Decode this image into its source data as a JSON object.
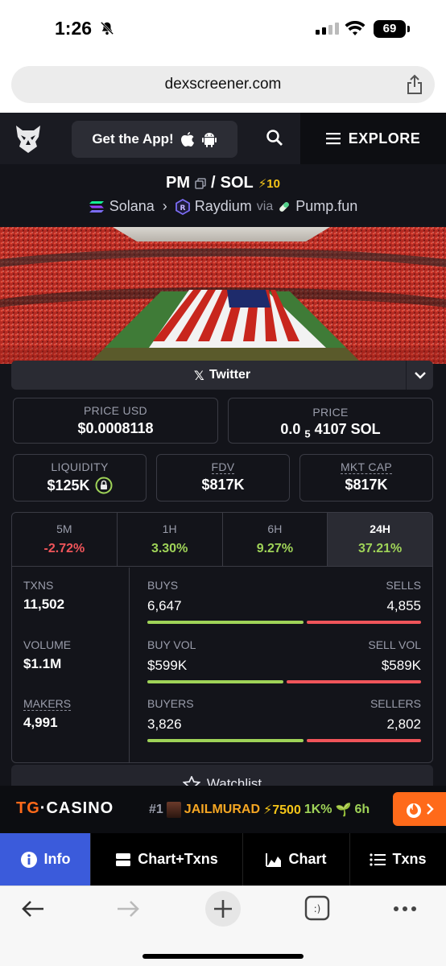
{
  "status": {
    "time": "1:26",
    "battery": "69"
  },
  "browser": {
    "url": "dexscreener.com"
  },
  "header": {
    "get_app": "Get the App!",
    "explore": "EXPLORE"
  },
  "pair": {
    "base": "PM",
    "sep": "/",
    "quote": "SOL",
    "boost": "⚡10",
    "chain": "Solana",
    "dex": "Raydium",
    "via": "via",
    "launchpad": "Pump.fun"
  },
  "social": {
    "twitter": "Twitter"
  },
  "prices": {
    "price_usd_label": "PRICE USD",
    "price_usd": "$0.0008118",
    "price_label": "PRICE",
    "price_sol_prefix": "0.0",
    "price_sol_sub": "5",
    "price_sol_rest": "4107 SOL"
  },
  "metrics": {
    "liquidity_label": "LIQUIDITY",
    "liquidity": "$125K",
    "fdv_label": "FDV",
    "fdv": "$817K",
    "mktcap_label": "MKT CAP",
    "mktcap": "$817K"
  },
  "timeframes": [
    {
      "label": "5M",
      "value": "-2.72%"
    },
    {
      "label": "1H",
      "value": "3.30%"
    },
    {
      "label": "6H",
      "value": "9.27%"
    },
    {
      "label": "24H",
      "value": "37.21%"
    }
  ],
  "stats": {
    "txns_label": "TXNS",
    "txns": "11,502",
    "volume_label": "VOLUME",
    "volume": "$1.1M",
    "makers_label": "MAKERS",
    "makers": "4,991",
    "buys_label": "BUYS",
    "buys": "6,647",
    "sells_label": "SELLS",
    "sells": "4,855",
    "buy_vol_label": "BUY VOL",
    "buy_vol": "$599K",
    "sell_vol_label": "SELL VOL",
    "sell_vol": "$589K",
    "buyers_label": "BUYERS",
    "buyers": "3,826",
    "sellers_label": "SELLERS",
    "sellers": "2,802",
    "buys_ratio": 0.578,
    "buy_vol_ratio": 0.504,
    "buyers_ratio": 0.577
  },
  "watchlist": "Watchlist",
  "ad": {
    "brand_a": "TG",
    "brand_b": "·CASINO",
    "rank": "#1",
    "name": "JAILMURAD",
    "boost": "⚡7500",
    "pct": "1K%",
    "age": "6h"
  },
  "bottom_nav": [
    "Info",
    "Chart+Txns",
    "Chart",
    "Txns"
  ],
  "colors": {
    "green": "#9fd358",
    "red": "#f0555a",
    "accent": "#3b5bdb",
    "orange": "#ff6a1a"
  }
}
